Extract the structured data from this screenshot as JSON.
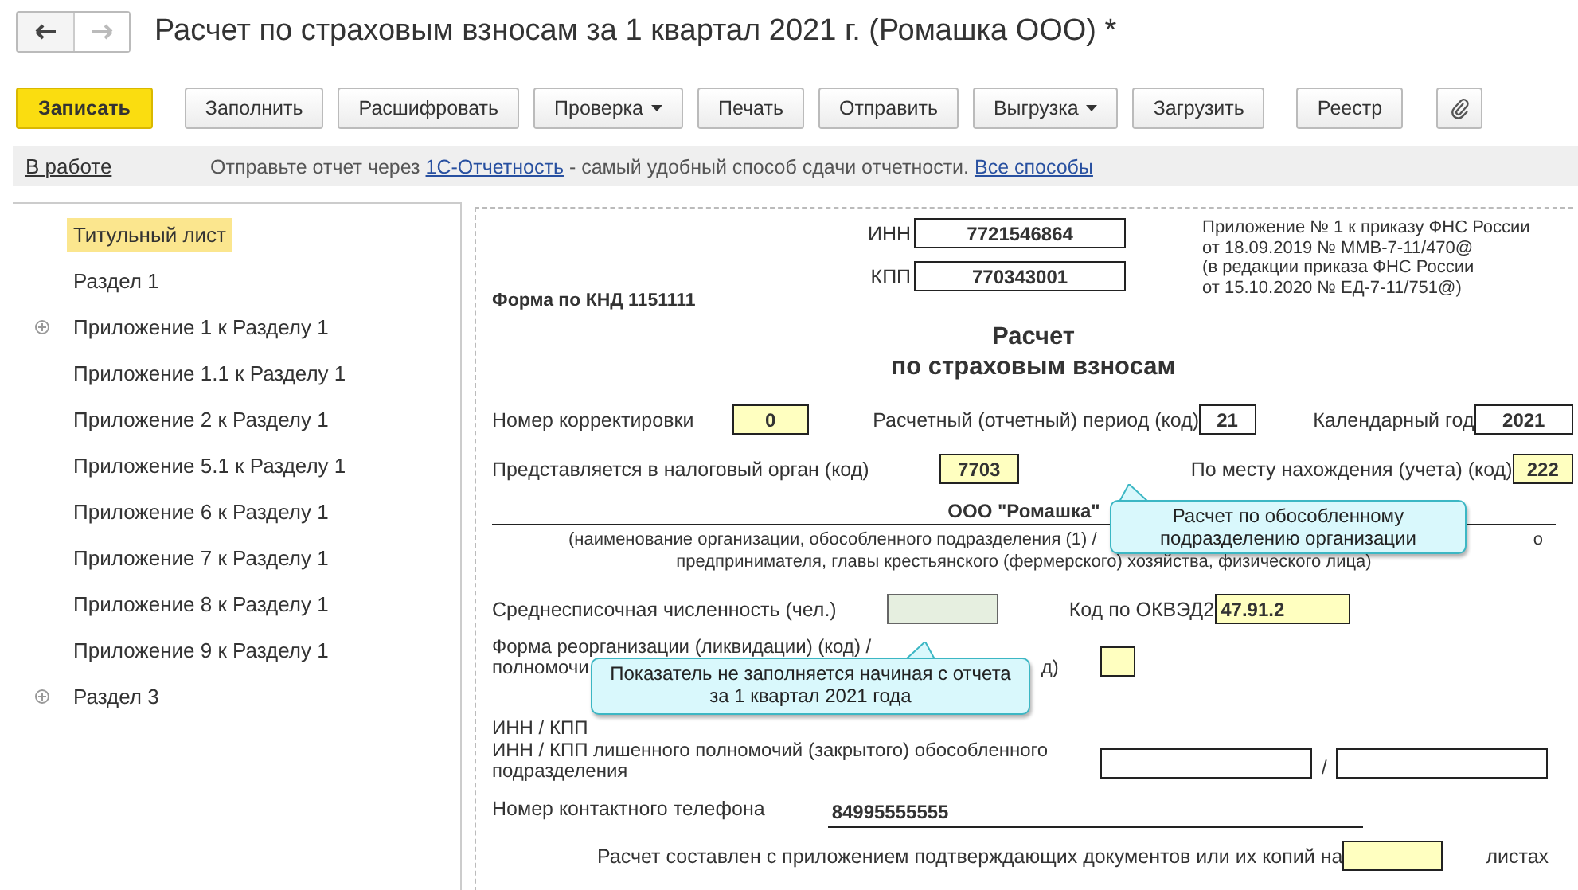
{
  "window": {
    "title": "Расчет по страховым взносам за 1 квартал 2021 г. (Ромашка ООО) *"
  },
  "toolbar": [
    {
      "kind": "primary",
      "label": "Записать"
    },
    {
      "kind": "button",
      "label": "Заполнить"
    },
    {
      "kind": "button",
      "label": "Расшифровать"
    },
    {
      "kind": "dropdown",
      "label": "Проверка"
    },
    {
      "kind": "button",
      "label": "Печать"
    },
    {
      "kind": "button",
      "label": "Отправить"
    },
    {
      "kind": "dropdown",
      "label": "Выгрузка"
    },
    {
      "kind": "button",
      "label": "Загрузить"
    },
    {
      "kind": "button",
      "label": "Реестр"
    },
    {
      "kind": "attach"
    }
  ],
  "info_bar": {
    "status": "В работе",
    "text_before": "Отправьте отчет через ",
    "link": "1С-Отчетность",
    "text_after": " - самый удобный способ сдачи отчетности. ",
    "link_2": "Все способы"
  },
  "sidebar": {
    "items": [
      {
        "label": "Титульный лист",
        "selected": true,
        "expandable": false
      },
      {
        "label": "Раздел 1",
        "selected": false,
        "expandable": false
      },
      {
        "label": "Приложение 1 к Разделу 1",
        "selected": false,
        "expandable": true
      },
      {
        "label": "Приложение 1.1 к Разделу 1",
        "selected": false,
        "expandable": false
      },
      {
        "label": "Приложение 2 к Разделу 1",
        "selected": false,
        "expandable": false
      },
      {
        "label": "Приложение 5.1 к Разделу 1",
        "selected": false,
        "expandable": false
      },
      {
        "label": "Приложение 6 к Разделу 1",
        "selected": false,
        "expandable": false
      },
      {
        "label": "Приложение 7 к Разделу 1",
        "selected": false,
        "expandable": false
      },
      {
        "label": "Приложение 8 к Разделу 1",
        "selected": false,
        "expandable": false
      },
      {
        "label": "Приложение 9 к Разделу 1",
        "selected": false,
        "expandable": false
      },
      {
        "label": "Раздел 3",
        "selected": false,
        "expandable": true
      }
    ]
  },
  "form": {
    "inn": {
      "label": "ИНН",
      "value": "7721546864"
    },
    "kpp": {
      "label": "КПП",
      "value": "770343001"
    },
    "order_note": [
      "Приложение № 1 к приказу ФНС России",
      "от 18.09.2019 № ММВ-7-11/470@",
      "(в редакции приказа ФНС России",
      "от 15.10.2020 № ЕД-7-11/751@)"
    ],
    "form_code": "Форма по КНД 1151111",
    "heading": [
      "Расчет",
      "по страховым взносам"
    ],
    "correction": {
      "label": "Номер корректировки",
      "value": "0"
    },
    "period": {
      "label": "Расчетный (отчетный) период (код)",
      "value": "21"
    },
    "year": {
      "label": "Календарный год",
      "value": "2021"
    },
    "tax_office": {
      "label": "Представляется в налоговый орган (код)",
      "value": "7703"
    },
    "location": {
      "label": "По месту нахождения (учета) (код)",
      "value": "222"
    },
    "organization": "ООО \"Ромашка\"",
    "org_caption_1a": "(наименование организации, обособленного подразделения (1) /",
    "org_caption_1b": "о",
    "org_caption_2": "предпринимателя, главы крестьянского (фермерского) хозяйства, физического лица)",
    "headcount": {
      "label": "Среднесписочная численность (чел.)",
      "disabled": true
    },
    "okved": {
      "label": "Код по ОКВЭД2",
      "value": "47.91.2"
    },
    "reorg_1": "Форма реорганизации (ликвидации) (код) /",
    "reorg_2a": "полномочи",
    "reorg_2b": "д)",
    "reorg_3": "ИНН / КПП",
    "closed_label": [
      "ИНН / КПП лишенного полномочий (закрытого) обособленного",
      "подразделения"
    ],
    "separator": "/",
    "phone": {
      "label": "Номер контактного телефона",
      "value": "84995555555"
    },
    "pages": {
      "before": "Расчет составлен с приложением подтверждающих документов или их копий на",
      "after": "листах"
    }
  },
  "tooltips": [
    {
      "text": "Расчет по обособленному подразделению организации"
    },
    {
      "text": "Показатель не заполняется начиная с отчета за 1 квартал 2021 года"
    }
  ]
}
